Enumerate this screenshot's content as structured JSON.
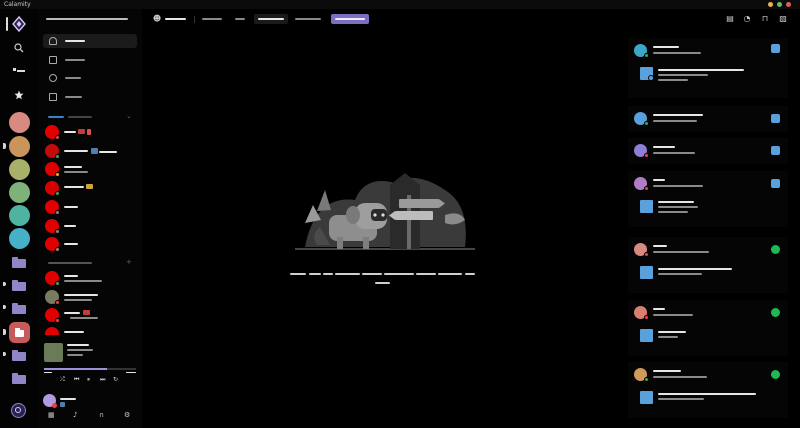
{
  "app": {
    "title": "Calamity"
  },
  "window_controls": {
    "colors": [
      "#e8b34b",
      "#5bbf6b",
      "#e05a5a"
    ]
  },
  "guild_rail": {
    "items": [
      {
        "name": "home-logo-icon"
      },
      {
        "name": "search-icon"
      },
      {
        "name": "quick-switch-icon"
      },
      {
        "name": "favorites-star-icon"
      }
    ],
    "servers": [
      "#d98a80",
      "#c9955a",
      "#a9b06a",
      "#7fb27a",
      "#4fb3a2",
      "#46b0c8"
    ],
    "folders_color": "#8f86c8",
    "selected_folder_color": "#c95a5a"
  },
  "channels": {
    "nav": [
      {
        "icon": "friends-icon",
        "active": true
      },
      {
        "icon": "library-icon",
        "active": false
      },
      {
        "icon": "nitro-icon",
        "active": false
      },
      {
        "icon": "shop-icon",
        "active": false
      }
    ]
  },
  "player": {
    "progress": 0.68
  },
  "topbar": {
    "icons": [
      "inbox-icon",
      "help-icon",
      "download-icon",
      "gallery-icon"
    ]
  },
  "activity": {
    "cards": [
      {
        "avatar": "#3da6c8",
        "status": "#3ba55d",
        "app": "app",
        "has_detail": true
      },
      {
        "avatar": "#5aa0dc",
        "status": "#3ba55d",
        "app": "app",
        "has_detail": false
      },
      {
        "avatar": "#8e7fd6",
        "status": "#ed4245",
        "app": "app",
        "has_detail": false
      },
      {
        "avatar": "#b07cc8",
        "status": "#ed4245",
        "app": "app",
        "has_detail": true
      },
      {
        "avatar": "#d98a80",
        "status": "#ed4245",
        "app": "spotify",
        "has_detail": true
      },
      {
        "avatar": "#d88070",
        "status": "#ed4245",
        "app": "spotify",
        "has_detail": true
      },
      {
        "avatar": "#d29a5a",
        "status": "#3ba55d",
        "app": "spotify",
        "has_detail": true
      }
    ]
  }
}
